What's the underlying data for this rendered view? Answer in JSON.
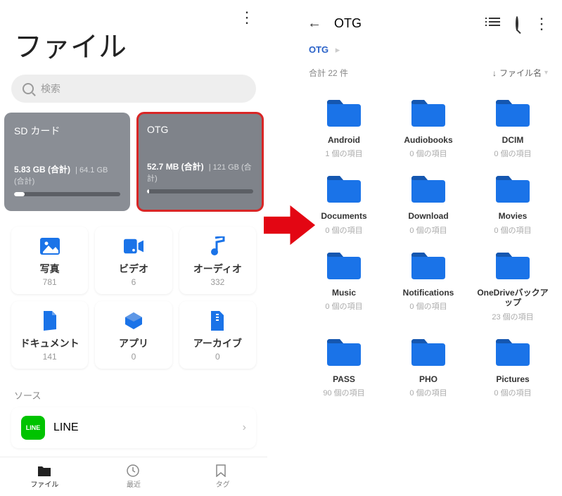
{
  "left": {
    "title": "ファイル",
    "search_placeholder": "検索",
    "storage": [
      {
        "name": "SD カード",
        "used": "5.83 GB (合計)",
        "total": "64.1 GB (合計)",
        "fill_pct": 10,
        "selected": false
      },
      {
        "name": "OTG",
        "used": "52.7 MB (合計)",
        "total": "121 GB (合計)",
        "fill_pct": 2,
        "selected": true
      }
    ],
    "categories": [
      {
        "icon": "photo-icon",
        "label": "写真",
        "count": "781"
      },
      {
        "icon": "video-icon",
        "label": "ビデオ",
        "count": "6"
      },
      {
        "icon": "audio-icon",
        "label": "オーディオ",
        "count": "332"
      },
      {
        "icon": "document-icon",
        "label": "ドキュメント",
        "count": "141"
      },
      {
        "icon": "app-icon",
        "label": "アプリ",
        "count": "0"
      },
      {
        "icon": "archive-icon",
        "label": "アーカイブ",
        "count": "0"
      }
    ],
    "source_label": "ソース",
    "sources": [
      {
        "name": "LINE"
      }
    ],
    "nav": [
      {
        "icon": "folder-solid-icon",
        "label": "ファイル",
        "active": true
      },
      {
        "icon": "clock-icon",
        "label": "最近",
        "active": false
      },
      {
        "icon": "bookmark-icon",
        "label": "タグ",
        "active": false
      }
    ]
  },
  "right": {
    "title": "OTG",
    "breadcrumb": "OTG",
    "total_label": "合計 22 件",
    "sort_label": "ファイル名",
    "folders": [
      {
        "name": "Android",
        "sub": "1 個の項目"
      },
      {
        "name": "Audiobooks",
        "sub": "0 個の項目"
      },
      {
        "name": "DCIM",
        "sub": "0 個の項目"
      },
      {
        "name": "Documents",
        "sub": "0 個の項目"
      },
      {
        "name": "Download",
        "sub": "0 個の項目"
      },
      {
        "name": "Movies",
        "sub": "0 個の項目"
      },
      {
        "name": "Music",
        "sub": "0 個の項目"
      },
      {
        "name": "Notifications",
        "sub": "0 個の項目"
      },
      {
        "name": "OneDriveバックアップ",
        "sub": "23 個の項目"
      },
      {
        "name": "PASS",
        "sub": "90 個の項目"
      },
      {
        "name": "PHO",
        "sub": "0 個の項目"
      },
      {
        "name": "Pictures",
        "sub": "0 個の項目"
      }
    ]
  }
}
